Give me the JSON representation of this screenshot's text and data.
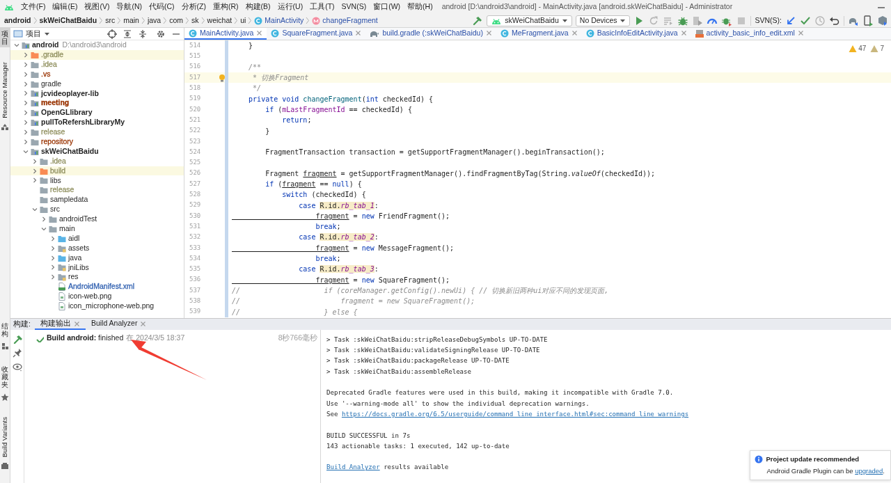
{
  "window": {
    "title": "android [D:\\android3\\android] - MainActivity.java [android.skWeiChatBaidu] - Administrator"
  },
  "menu": [
    "文件(F)",
    "编辑(E)",
    "视图(V)",
    "导航(N)",
    "代码(C)",
    "分析(Z)",
    "重构(R)",
    "构建(B)",
    "运行(U)",
    "工具(T)",
    "SVN(S)",
    "窗口(W)",
    "帮助(H)"
  ],
  "breadcrumb": [
    {
      "label": "android",
      "kind": "module"
    },
    {
      "label": "skWeiChatBaidu",
      "kind": "module"
    },
    {
      "label": "src",
      "kind": "dir"
    },
    {
      "label": "main",
      "kind": "dir"
    },
    {
      "label": "java",
      "kind": "dir"
    },
    {
      "label": "com",
      "kind": "dir"
    },
    {
      "label": "sk",
      "kind": "dir"
    },
    {
      "label": "weichat",
      "kind": "dir"
    },
    {
      "label": "ui",
      "kind": "dir"
    },
    {
      "label": "MainActivity",
      "kind": "class"
    },
    {
      "label": "changeFragment",
      "kind": "method"
    }
  ],
  "toolbar": {
    "run_config": "skWeiChatBaidu",
    "device": "No Devices",
    "svn_label": "SVN(S):"
  },
  "side_tabs_top": [
    {
      "label": "项目",
      "kind": "cjk",
      "selected": true
    },
    {
      "label": "Resource Manager",
      "kind": "latin",
      "selected": false
    }
  ],
  "side_tabs_bottom": [
    {
      "label": "结构",
      "kind": "cjk",
      "selected": false
    },
    {
      "label": "收藏夹",
      "kind": "cjk",
      "selected": false
    },
    {
      "label": "Build Variants",
      "kind": "latin",
      "selected": false
    }
  ],
  "project": {
    "title": "项目",
    "tree": [
      {
        "name": "android",
        "path": "D:\\android3\\android",
        "kind": "module",
        "bold": true,
        "expandable": true,
        "expanded": true,
        "highlighted": false,
        "children": [
          {
            "name": ".gradle",
            "kind": "excluded",
            "bold": false,
            "color": "#8f8f5e",
            "expandable": true,
            "expanded": false,
            "highlighted": true
          },
          {
            "name": ".idea",
            "kind": "folder",
            "bold": false,
            "color": "#8f8f5e",
            "expandable": true,
            "expanded": false,
            "highlighted": false
          },
          {
            "name": ".vs",
            "kind": "folder",
            "bold": false,
            "color": "#993300",
            "expandable": true,
            "expanded": false,
            "highlighted": false
          },
          {
            "name": "gradle",
            "kind": "folder",
            "bold": false,
            "expandable": true,
            "expanded": false,
            "highlighted": false
          },
          {
            "name": "jcvideoplayer-lib",
            "kind": "module",
            "bold": true,
            "expandable": true,
            "expanded": false,
            "highlighted": false
          },
          {
            "name": "meeting",
            "kind": "module",
            "bold": true,
            "color": "#993300",
            "expandable": true,
            "expanded": false,
            "highlighted": false
          },
          {
            "name": "OpenGLlibrary",
            "kind": "module",
            "bold": true,
            "expandable": true,
            "expanded": false,
            "highlighted": false
          },
          {
            "name": "pullToRefershLibraryMy",
            "kind": "module",
            "bold": true,
            "expandable": true,
            "expanded": false,
            "highlighted": false
          },
          {
            "name": "release",
            "kind": "folder",
            "bold": false,
            "color": "#8f8f5e",
            "expandable": true,
            "expanded": false,
            "highlighted": false
          },
          {
            "name": "repository",
            "kind": "folder",
            "bold": false,
            "color": "#993300",
            "expandable": true,
            "expanded": false,
            "highlighted": false
          },
          {
            "name": "skWeiChatBaidu",
            "kind": "app",
            "bold": true,
            "expandable": true,
            "expanded": true,
            "highlighted": false,
            "children": [
              {
                "name": ".idea",
                "kind": "folder",
                "bold": false,
                "color": "#8f8f5e",
                "expandable": true,
                "expanded": false,
                "highlighted": false
              },
              {
                "name": "build",
                "kind": "excluded",
                "bold": false,
                "color": "#8f8f5e",
                "expandable": true,
                "expanded": false,
                "highlighted": true
              },
              {
                "name": "libs",
                "kind": "folder",
                "bold": false,
                "expandable": true,
                "expanded": false,
                "highlighted": false
              },
              {
                "name": "release",
                "kind": "folder",
                "bold": false,
                "color": "#8f8f5e",
                "expandable": false,
                "highlighted": false
              },
              {
                "name": "sampledata",
                "kind": "folder",
                "bold": false,
                "expandable": false,
                "highlighted": false
              },
              {
                "name": "src",
                "kind": "folder",
                "bold": false,
                "expandable": true,
                "expanded": true,
                "highlighted": false,
                "children": [
                  {
                    "name": "androidTest",
                    "kind": "folder",
                    "bold": false,
                    "expandable": true,
                    "expanded": false,
                    "highlighted": false
                  },
                  {
                    "name": "main",
                    "kind": "folder",
                    "bold": false,
                    "expandable": true,
                    "expanded": true,
                    "highlighted": false,
                    "children": [
                      {
                        "name": "aidl",
                        "kind": "source",
                        "bold": false,
                        "expandable": true,
                        "expanded": false,
                        "highlighted": false
                      },
                      {
                        "name": "assets",
                        "kind": "resources",
                        "bold": false,
                        "expandable": true,
                        "expanded": false,
                        "highlighted": false
                      },
                      {
                        "name": "java",
                        "kind": "source",
                        "bold": false,
                        "expandable": true,
                        "expanded": false,
                        "highlighted": false
                      },
                      {
                        "name": "jniLibs",
                        "kind": "resources",
                        "bold": false,
                        "expandable": true,
                        "expanded": false,
                        "highlighted": false
                      },
                      {
                        "name": "res",
                        "kind": "resources",
                        "bold": false,
                        "expandable": true,
                        "expanded": false,
                        "highlighted": false
                      },
                      {
                        "name": "AndroidManifest.xml",
                        "kind": "manifest",
                        "bold": false,
                        "color": "#3060b0",
                        "expandable": false,
                        "highlighted": false
                      },
                      {
                        "name": "icon-web.png",
                        "kind": "image",
                        "bold": false,
                        "expandable": false,
                        "highlighted": false
                      },
                      {
                        "name": "icon_microphone-web.png",
                        "kind": "image",
                        "bold": false,
                        "expandable": false,
                        "highlighted": false
                      }
                    ]
                  }
                ]
              }
            ]
          }
        ]
      }
    ]
  },
  "editor_tabs": [
    {
      "label": "MainActivity.java",
      "kind": "class",
      "selected": true
    },
    {
      "label": "SquareFragment.java",
      "kind": "class",
      "selected": false
    },
    {
      "label": "build.gradle (:skWeiChatBaidu)",
      "kind": "gradle",
      "selected": false
    },
    {
      "label": "MeFragment.java",
      "kind": "class",
      "selected": false
    },
    {
      "label": "BasicInfoEditActivity.java",
      "kind": "class",
      "selected": false
    },
    {
      "label": "activity_basic_info_edit.xml",
      "kind": "xml",
      "selected": false
    }
  ],
  "inspections": [
    {
      "kind": "warning",
      "count": "47"
    },
    {
      "kind": "weak",
      "count": "7"
    }
  ],
  "code": [
    {
      "number": "514",
      "current": false,
      "tokens": [
        {
          "text": "    }",
          "kind": "plain"
        }
      ]
    },
    {
      "number": "515",
      "current": false
    },
    {
      "number": "516",
      "current": false,
      "tokens": [
        {
          "text": "    /**",
          "kind": "comment"
        }
      ]
    },
    {
      "number": "517",
      "current": true,
      "tokens": [
        {
          "text": "     * 切换Fragment",
          "kind": "comment"
        }
      ]
    },
    {
      "number": "518",
      "current": false,
      "tokens": [
        {
          "text": "     */",
          "kind": "comment"
        }
      ]
    },
    {
      "number": "519",
      "current": false,
      "tokens": [
        {
          "text": "    private void ",
          "kind": "keyword"
        },
        {
          "text": "changeFragment",
          "kind": "method"
        },
        {
          "text": "(",
          "kind": "plain"
        },
        {
          "text": "int ",
          "kind": "keyword"
        },
        {
          "text": "checkedId) {",
          "kind": "plain"
        }
      ]
    },
    {
      "number": "520",
      "current": false,
      "tokens": [
        {
          "text": "        if ",
          "kind": "keyword"
        },
        {
          "text": "(",
          "kind": "plain"
        },
        {
          "text": "mLastFragmentId",
          "kind": "field"
        },
        {
          "text": " == checkedId) {",
          "kind": "plain"
        }
      ]
    },
    {
      "number": "521",
      "current": false,
      "tokens": [
        {
          "text": "            return",
          "kind": "keyword"
        },
        {
          "text": ";",
          "kind": "plain"
        }
      ]
    },
    {
      "number": "522",
      "current": false,
      "tokens": [
        {
          "text": "        }",
          "kind": "plain"
        }
      ]
    },
    {
      "number": "523",
      "current": false
    },
    {
      "number": "524",
      "current": false,
      "tokens": [
        {
          "text": "        FragmentTransaction transaction = getSupportFragmentManager().beginTransaction();",
          "kind": "plain"
        }
      ]
    },
    {
      "number": "525",
      "current": false
    },
    {
      "number": "526",
      "current": false,
      "tokens": [
        {
          "text": "        Fragment ",
          "kind": "plain"
        },
        {
          "text": "fragment",
          "kind": "variable"
        },
        {
          "text": " = getSupportFragmentManager().findFragmentByTag(String.",
          "kind": "plain"
        },
        {
          "text": "valueOf",
          "kind": "static"
        },
        {
          "text": "(checkedId));",
          "kind": "plain"
        }
      ]
    },
    {
      "number": "527",
      "current": false,
      "tokens": [
        {
          "text": "        if ",
          "kind": "keyword"
        },
        {
          "text": "(",
          "kind": "plain"
        },
        {
          "text": "fragment",
          "kind": "variable"
        },
        {
          "text": " == ",
          "kind": "plain"
        },
        {
          "text": "null",
          "kind": "keyword"
        },
        {
          "text": ") {",
          "kind": "plain"
        }
      ]
    },
    {
      "number": "528",
      "current": false,
      "tokens": [
        {
          "text": "            switch ",
          "kind": "keyword"
        },
        {
          "text": "(checkedId) {",
          "kind": "plain"
        }
      ]
    },
    {
      "number": "529",
      "current": false,
      "tokens": [
        {
          "text": "                case ",
          "kind": "keyword"
        },
        {
          "text": "R.id.",
          "kind": "ref"
        },
        {
          "text": "rb_tab_1",
          "kind": "reffield"
        },
        {
          "text": ":",
          "kind": "plain"
        }
      ]
    },
    {
      "number": "530",
      "current": false,
      "tokens": [
        {
          "text": "                    fragment",
          "kind": "variable"
        },
        {
          "text": " = ",
          "kind": "plain"
        },
        {
          "text": "new ",
          "kind": "keyword"
        },
        {
          "text": "FriendFragment();",
          "kind": "plain"
        }
      ]
    },
    {
      "number": "531",
      "current": false,
      "tokens": [
        {
          "text": "                    break",
          "kind": "keyword"
        },
        {
          "text": ";",
          "kind": "plain"
        }
      ]
    },
    {
      "number": "532",
      "current": false,
      "tokens": [
        {
          "text": "                case ",
          "kind": "keyword"
        },
        {
          "text": "R.id.",
          "kind": "ref"
        },
        {
          "text": "rb_tab_2",
          "kind": "reffield"
        },
        {
          "text": ":",
          "kind": "plain"
        }
      ]
    },
    {
      "number": "533",
      "current": false,
      "tokens": [
        {
          "text": "                    fragment",
          "kind": "variable"
        },
        {
          "text": " = ",
          "kind": "plain"
        },
        {
          "text": "new ",
          "kind": "keyword"
        },
        {
          "text": "MessageFragment();",
          "kind": "plain"
        }
      ]
    },
    {
      "number": "534",
      "current": false,
      "tokens": [
        {
          "text": "                    break",
          "kind": "keyword"
        },
        {
          "text": ";",
          "kind": "plain"
        }
      ]
    },
    {
      "number": "535",
      "current": false,
      "tokens": [
        {
          "text": "                case ",
          "kind": "keyword"
        },
        {
          "text": "R.id.",
          "kind": "ref"
        },
        {
          "text": "rb_tab_3",
          "kind": "reffield"
        },
        {
          "text": ":",
          "kind": "plain"
        }
      ]
    },
    {
      "number": "536",
      "current": false,
      "tokens": [
        {
          "text": "                    fragment",
          "kind": "variable"
        },
        {
          "text": " = ",
          "kind": "plain"
        },
        {
          "text": "new ",
          "kind": "keyword"
        },
        {
          "text": "SquareFragment();",
          "kind": "plain"
        }
      ]
    },
    {
      "number": "537",
      "current": false,
      "tokens": [
        {
          "text": "//                    if (coreManager.getConfig().newUi) { // 切换新旧两种ui对应不同的发现页面,",
          "kind": "comment"
        }
      ]
    },
    {
      "number": "538",
      "current": false,
      "tokens": [
        {
          "text": "//                        fragment = new SquareFragment();",
          "kind": "comment"
        }
      ]
    },
    {
      "number": "539",
      "current": false,
      "tokens": [
        {
          "text": "//                    } else {",
          "kind": "comment"
        }
      ]
    }
  ],
  "build_panel": {
    "label": "构建:",
    "tabs": [
      {
        "label": "构建输出",
        "selected": true
      },
      {
        "label": "Build Analyzer",
        "selected": false
      }
    ],
    "result": {
      "status": "**Build android:** finished",
      "time": "在 2024/3/5 18:37",
      "duration": "8秒766毫秒"
    },
    "console": [
      {
        "kind": "line",
        "segments": [
          {
            "text": "> Task :skWeiChatBaidu:stripReleaseDebugSymbols UP-TO-DATE",
            "link": false
          }
        ]
      },
      {
        "kind": "line",
        "segments": [
          {
            "text": "> Task :skWeiChatBaidu:validateSigningRelease UP-TO-DATE",
            "link": false
          }
        ]
      },
      {
        "kind": "line",
        "segments": [
          {
            "text": "> Task :skWeiChatBaidu:packageRelease UP-TO-DATE",
            "link": false
          }
        ]
      },
      {
        "kind": "line",
        "segments": [
          {
            "text": "> Task :skWeiChatBaidu:assembleRelease",
            "link": false
          }
        ]
      },
      {
        "kind": "blank"
      },
      {
        "kind": "line",
        "segments": [
          {
            "text": "Deprecated Gradle features were used in this build, making it incompatible with Gradle 7.0.",
            "link": false
          }
        ]
      },
      {
        "kind": "line",
        "segments": [
          {
            "text": "Use '--warning-mode all' to show the individual deprecation warnings.",
            "link": false
          }
        ]
      },
      {
        "kind": "line",
        "segments": [
          {
            "text": "See ",
            "link": false
          },
          {
            "text": "https://docs.gradle.org/6.5/userguide/command_line_interface.html#sec:command_line_warnings",
            "link": true
          }
        ]
      },
      {
        "kind": "blank"
      },
      {
        "kind": "line",
        "segments": [
          {
            "text": "BUILD SUCCESSFUL in 7s",
            "link": false
          }
        ]
      },
      {
        "kind": "line",
        "segments": [
          {
            "text": "143 actionable tasks: 1 executed, 142 up-to-date",
            "link": false
          }
        ]
      },
      {
        "kind": "blank"
      },
      {
        "kind": "line",
        "segments": [
          {
            "text": "Build Analyzer",
            "link": true
          },
          {
            "text": " results available",
            "link": false
          }
        ]
      }
    ]
  },
  "notification": {
    "title": "Project update recommended",
    "text": "Android Gradle Plugin can be ",
    "link": "upgraded",
    "suffix": "."
  }
}
